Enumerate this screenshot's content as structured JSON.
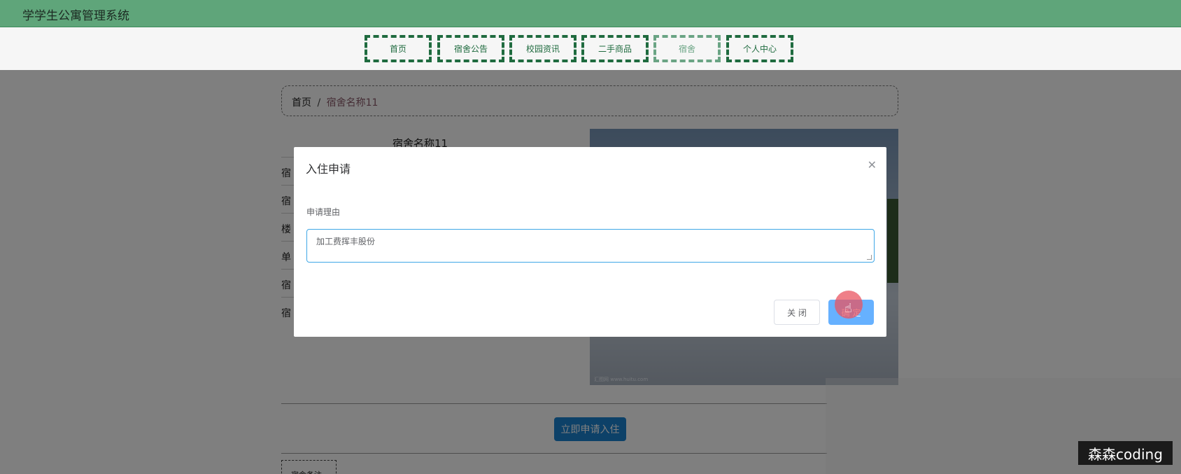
{
  "app": {
    "title": "学学生公寓管理系统"
  },
  "nav": {
    "items": [
      {
        "label": "首页"
      },
      {
        "label": "宿舍公告"
      },
      {
        "label": "校园资讯"
      },
      {
        "label": "二手商品"
      },
      {
        "label": "宿舍"
      },
      {
        "label": "个人中心"
      }
    ],
    "active": "宿舍"
  },
  "breadcrumb": {
    "home": "首页",
    "separator": "/",
    "current": "宿舍名称11"
  },
  "detail": {
    "name": "宿舍名称11",
    "row_prefixes": [
      "宿",
      "宿",
      "楼",
      "单",
      "宿",
      "宿"
    ],
    "photo_watermark": "汇图网 www.huitu.com",
    "apply_label": "立即申请入住",
    "remark_tab": "宿舍备注"
  },
  "dialog": {
    "title": "入住申请",
    "close_icon": "close-icon",
    "field_label": "申请理由",
    "field_value": "加工费挥丰股份",
    "close_label": "关 闭",
    "confirm_label": "确 定"
  },
  "colors": {
    "header": "#5fa57a",
    "nav_border": "#1f6b3f",
    "primary": "#1a82d0",
    "confirm": "#66b1ff"
  },
  "watermark": "森森coding"
}
